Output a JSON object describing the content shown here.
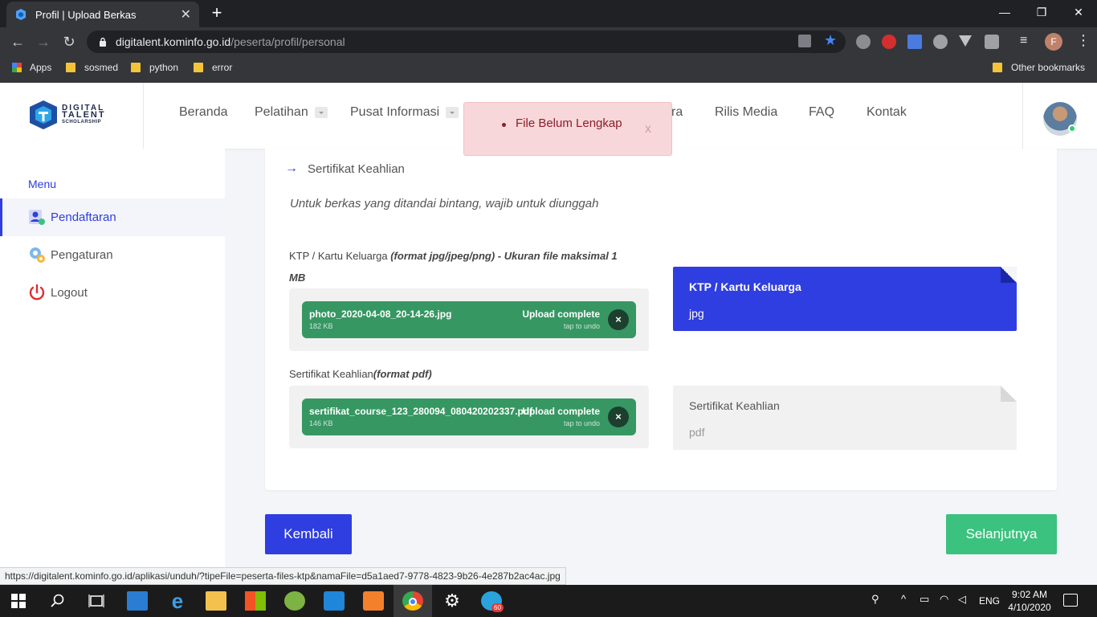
{
  "browser": {
    "tab_title": "Profil | Upload Berkas",
    "tab_close": "✕",
    "new_tab": "+",
    "url_host": "digitalent.kominfo.go.id",
    "url_path": "/peserta/profil/personal",
    "window_min": "—",
    "window_max": "❐",
    "window_close": "✕",
    "profile_initial": "F",
    "bookmarks": [
      {
        "label": "Apps"
      },
      {
        "label": "sosmed"
      },
      {
        "label": "python"
      },
      {
        "label": "error"
      }
    ],
    "other_bookmarks": "Other bookmarks",
    "status_url": "https://digitalent.kominfo.go.id/aplikasi/unduh/?tipeFile=peserta-files-ktp&namaFile=d5a1aed7-9778-4823-9b26-4e287b2ac4ac.jpg"
  },
  "site": {
    "logo_line1": "DIGITAL",
    "logo_line2": "TALENT",
    "logo_line3": "SCHOLARSHIP",
    "nav": [
      {
        "label": "Beranda"
      },
      {
        "label": "Pelatihan"
      },
      {
        "label": "Pusat Informasi"
      },
      {
        "label": "ra"
      },
      {
        "label": "Rilis Media"
      },
      {
        "label": "FAQ"
      },
      {
        "label": "Kontak"
      }
    ]
  },
  "sidebar": {
    "menu_label": "Menu",
    "items": [
      {
        "label": "Pendaftaran"
      },
      {
        "label": "Pengaturan"
      },
      {
        "label": "Logout"
      }
    ]
  },
  "alert": {
    "message": "File Belum Lengkap",
    "close": "x"
  },
  "main": {
    "section_title": "Sertifikat Keahlian",
    "note": "Untuk berkas yang ditandai bintang, wajib untuk diunggah",
    "fields": [
      {
        "label_plain": "KTP / Kartu Keluarga ",
        "label_italic": "(format jpg/jpeg/png) - Ukuran file maksimal 1",
        "label_italic_cont": "MB",
        "file_name": "photo_2020-04-08_20-14-26.jpg",
        "file_size": "182 KB",
        "status": "Upload complete",
        "undo": "tap to undo",
        "close": "×",
        "doc_title": "KTP / Kartu Keluarga",
        "doc_type": "jpg"
      },
      {
        "label_plain": "Sertifikat Keahlian",
        "label_italic": "(format pdf)",
        "file_name": "sertifikat_course_123_280094_080420202337.pdf",
        "file_size": "146 KB",
        "status": "Upload complete",
        "undo": "tap to undo",
        "close": "×",
        "doc_title": "Sertifikat Keahlian",
        "doc_type": "pdf"
      }
    ],
    "back_button": "Kembali",
    "next_button": "Selanjutnya"
  },
  "taskbar": {
    "language": "ENG",
    "time": "9:02 AM",
    "date": "4/10/2020",
    "telegram_badge": "60"
  },
  "colors": {
    "primary": "#2f3ee0",
    "success": "#369763",
    "next": "#3cc27f",
    "alert_bg": "#f8d7da"
  }
}
